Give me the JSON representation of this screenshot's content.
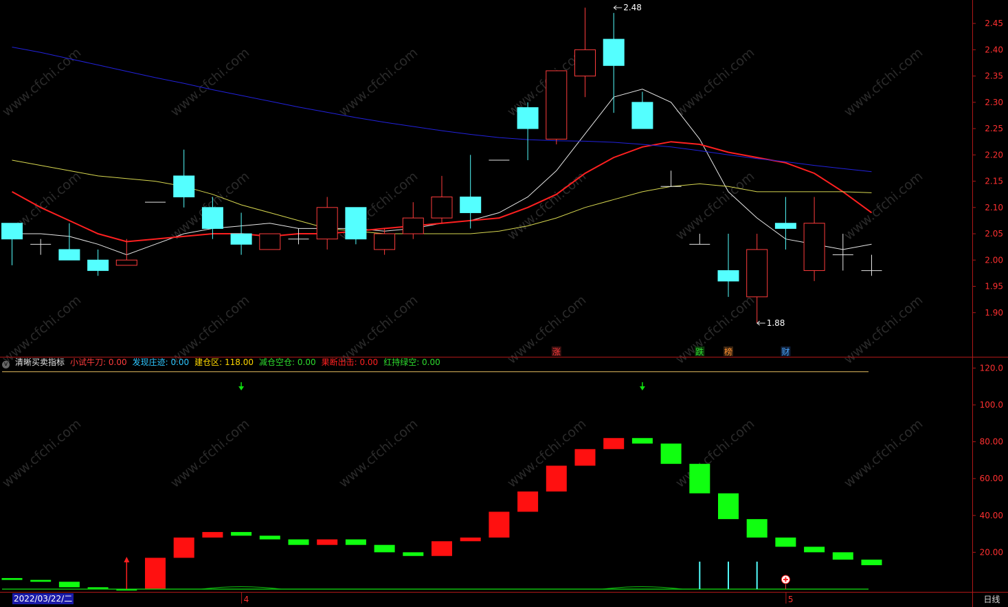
{
  "colors": {
    "up": "#ff3c3c",
    "down": "#54ffff",
    "flat": "#e6e6e6",
    "axis": "#b01818",
    "ma_white": "#e8e8e8",
    "ma_red": "#ff2020",
    "ma_yellow": "#d8d850",
    "ma_blue": "#2222dd",
    "bar_red": "#ff1010",
    "bar_green": "#10ff10"
  },
  "indicator": {
    "collapse_icon": "chevron-down-icon",
    "name": "清晰买卖指标",
    "items": [
      {
        "label": "小试牛刀:",
        "value": "0.00",
        "color": "#ff3c3c"
      },
      {
        "label": "发现庄迹:",
        "value": "0.00",
        "color": "#2ec6ff"
      },
      {
        "label": "建仓区:",
        "value": "118.00",
        "color": "#ffd800"
      },
      {
        "label": "减仓空仓:",
        "value": "0.00",
        "color": "#2edc2e"
      },
      {
        "label": "果断出击:",
        "value": "0.00",
        "color": "#ff2020"
      },
      {
        "label": "红持绿空:",
        "value": "0.00",
        "color": "#2edc2e"
      }
    ]
  },
  "footer": {
    "date": "2022/03/22/二",
    "period": "日线"
  },
  "chart_data": [
    {
      "type": "candlestick",
      "ylim": [
        1.85,
        2.475
      ],
      "y_ticks": [
        "2.45",
        "2.40",
        "2.35",
        "2.30",
        "2.25",
        "2.20",
        "2.15",
        "2.10",
        "2.05",
        "2.00",
        "1.95",
        "1.90"
      ],
      "x_ticks": [
        {
          "index": 8,
          "label": "4"
        },
        {
          "index": 27,
          "label": "5"
        }
      ],
      "candles": [
        {
          "o": 2.07,
          "h": 2.07,
          "l": 1.99,
          "c": 2.04
        },
        {
          "o": 2.03,
          "h": 2.04,
          "l": 2.01,
          "c": 2.03
        },
        {
          "o": 2.02,
          "h": 2.07,
          "l": 2.0,
          "c": 2.0
        },
        {
          "o": 2.0,
          "h": 2.02,
          "l": 1.97,
          "c": 1.98
        },
        {
          "o": 1.99,
          "h": 2.04,
          "l": 1.99,
          "c": 2.0
        },
        {
          "o": 2.11,
          "h": 2.11,
          "l": 2.11,
          "c": 2.11
        },
        {
          "o": 2.16,
          "h": 2.21,
          "l": 2.1,
          "c": 2.12
        },
        {
          "o": 2.1,
          "h": 2.12,
          "l": 2.04,
          "c": 2.06
        },
        {
          "o": 2.05,
          "h": 2.09,
          "l": 2.01,
          "c": 2.03
        },
        {
          "o": 2.02,
          "h": 2.05,
          "l": 2.02,
          "c": 2.05
        },
        {
          "o": 2.04,
          "h": 2.06,
          "l": 2.03,
          "c": 2.04
        },
        {
          "o": 2.04,
          "h": 2.12,
          "l": 2.02,
          "c": 2.1
        },
        {
          "o": 2.1,
          "h": 2.1,
          "l": 2.03,
          "c": 2.04
        },
        {
          "o": 2.02,
          "h": 2.06,
          "l": 2.01,
          "c": 2.05
        },
        {
          "o": 2.05,
          "h": 2.11,
          "l": 2.04,
          "c": 2.08
        },
        {
          "o": 2.08,
          "h": 2.16,
          "l": 2.07,
          "c": 2.12
        },
        {
          "o": 2.12,
          "h": 2.2,
          "l": 2.06,
          "c": 2.09
        },
        {
          "o": 2.19,
          "h": 2.19,
          "l": 2.19,
          "c": 2.19
        },
        {
          "o": 2.29,
          "h": 2.3,
          "l": 2.19,
          "c": 2.25
        },
        {
          "o": 2.23,
          "h": 2.36,
          "l": 2.22,
          "c": 2.36
        },
        {
          "o": 2.35,
          "h": 2.48,
          "l": 2.31,
          "c": 2.4
        },
        {
          "o": 2.42,
          "h": 2.47,
          "l": 2.28,
          "c": 2.37
        },
        {
          "o": 2.3,
          "h": 2.32,
          "l": 2.25,
          "c": 2.25
        },
        {
          "o": 2.14,
          "h": 2.17,
          "l": 2.14,
          "c": 2.14
        },
        {
          "o": 2.03,
          "h": 2.05,
          "l": 2.03,
          "c": 2.03
        },
        {
          "o": 1.98,
          "h": 2.05,
          "l": 1.93,
          "c": 1.96
        },
        {
          "o": 1.93,
          "h": 2.05,
          "l": 1.88,
          "c": 2.02
        },
        {
          "o": 2.07,
          "h": 2.12,
          "l": 2.02,
          "c": 2.06
        },
        {
          "o": 1.98,
          "h": 2.12,
          "l": 1.96,
          "c": 2.07
        },
        {
          "o": 2.01,
          "h": 2.05,
          "l": 1.98,
          "c": 2.01
        },
        {
          "o": 1.98,
          "h": 2.01,
          "l": 1.97,
          "c": 1.98
        }
      ],
      "ma": [
        {
          "color": "#e8e8e8",
          "values": [
            2.05,
            2.05,
            2.045,
            2.03,
            2.01,
            2.03,
            2.05,
            2.06,
            2.065,
            2.07,
            2.06,
            2.06,
            2.06,
            2.055,
            2.06,
            2.07,
            2.075,
            2.09,
            2.12,
            2.17,
            2.24,
            2.31,
            2.325,
            2.3,
            2.23,
            2.13,
            2.08,
            2.04,
            2.03,
            2.02,
            2.03
          ]
        },
        {
          "color": "#ff2020",
          "width": 2,
          "values": [
            2.13,
            2.1,
            2.075,
            2.05,
            2.035,
            2.04,
            2.045,
            2.05,
            2.05,
            2.045,
            2.05,
            2.05,
            2.055,
            2.06,
            2.065,
            2.07,
            2.075,
            2.08,
            2.1,
            2.125,
            2.165,
            2.195,
            2.215,
            2.225,
            2.22,
            2.205,
            2.195,
            2.185,
            2.165,
            2.13,
            2.09
          ]
        },
        {
          "color": "#d8d850",
          "values": [
            2.19,
            2.18,
            2.17,
            2.16,
            2.155,
            2.15,
            2.14,
            2.125,
            2.105,
            2.09,
            2.075,
            2.06,
            2.055,
            2.05,
            2.05,
            2.05,
            2.05,
            2.055,
            2.065,
            2.08,
            2.1,
            2.115,
            2.13,
            2.14,
            2.145,
            2.14,
            2.13,
            2.13,
            2.13,
            2.13,
            2.128
          ]
        },
        {
          "color": "#2222dd",
          "values": [
            2.405,
            2.395,
            2.383,
            2.371,
            2.359,
            2.347,
            2.336,
            2.324,
            2.313,
            2.302,
            2.291,
            2.281,
            2.271,
            2.262,
            2.254,
            2.246,
            2.239,
            2.233,
            2.229,
            2.227,
            2.226,
            2.224,
            2.22,
            2.215,
            2.208,
            2.2,
            2.193,
            2.187,
            2.18,
            2.174,
            2.168
          ]
        }
      ],
      "annotations": [
        {
          "index": 21,
          "value": 2.48,
          "label": "2.48"
        },
        {
          "index": 26,
          "value": 1.88,
          "label": "1.88"
        }
      ],
      "badges": [
        {
          "index": 19,
          "label": "涨",
          "color": "#ff3c3c",
          "bg": "#3a1010"
        },
        {
          "index": 24,
          "label": "跌",
          "color": "#2edc2e",
          "bg": "#0e3a0e"
        },
        {
          "index": 25,
          "label": "榜",
          "color": "#ff9030",
          "bg": "#3a2410"
        },
        {
          "index": 27,
          "label": "财",
          "color": "#4aa8ff",
          "bg": "#10203a"
        }
      ]
    },
    {
      "type": "bar",
      "ylim": [
        0,
        125
      ],
      "y_ticks": [
        "120.0",
        "100.0",
        "80.00",
        "60.00",
        "40.00",
        "20.00"
      ],
      "reference_line": 118,
      "segments": [
        {
          "from": 6,
          "to": 5,
          "color": "green"
        },
        {
          "from": 5,
          "to": 4,
          "color": "green"
        },
        {
          "from": 4,
          "to": 1,
          "color": "green"
        },
        {
          "from": 1,
          "to": 0,
          "color": "green"
        },
        {
          "from": 0,
          "to": 0,
          "color": "green"
        },
        {
          "from": 0,
          "to": 17,
          "color": "red"
        },
        {
          "from": 17,
          "to": 28,
          "color": "red"
        },
        {
          "from": 28,
          "to": 31,
          "color": "red"
        },
        {
          "from": 31,
          "to": 29,
          "color": "green"
        },
        {
          "from": 29,
          "to": 27,
          "color": "green"
        },
        {
          "from": 27,
          "to": 24,
          "color": "green"
        },
        {
          "from": 24,
          "to": 27,
          "color": "red"
        },
        {
          "from": 27,
          "to": 24,
          "color": "green"
        },
        {
          "from": 24,
          "to": 20,
          "color": "green"
        },
        {
          "from": 20,
          "to": 18,
          "color": "green"
        },
        {
          "from": 18,
          "to": 26,
          "color": "red"
        },
        {
          "from": 26,
          "to": 28,
          "color": "red"
        },
        {
          "from": 28,
          "to": 42,
          "color": "red"
        },
        {
          "from": 42,
          "to": 53,
          "color": "red"
        },
        {
          "from": 53,
          "to": 67,
          "color": "red"
        },
        {
          "from": 67,
          "to": 76,
          "color": "red"
        },
        {
          "from": 76,
          "to": 82,
          "color": "red"
        },
        {
          "from": 82,
          "to": 79,
          "color": "green"
        },
        {
          "from": 79,
          "to": 68,
          "color": "green"
        },
        {
          "from": 68,
          "to": 52,
          "color": "green"
        },
        {
          "from": 52,
          "to": 38,
          "color": "green"
        },
        {
          "from": 38,
          "to": 28,
          "color": "green"
        },
        {
          "from": 28,
          "to": 23,
          "color": "green"
        },
        {
          "from": 23,
          "to": 20,
          "color": "green"
        },
        {
          "from": 20,
          "to": 16,
          "color": "green"
        },
        {
          "from": 16,
          "to": 13,
          "color": "green"
        }
      ],
      "down_arrows": [
        8,
        22
      ],
      "up_arrow": 4,
      "cyan_spikes": [
        24,
        25,
        26
      ],
      "plus_marker": 27
    }
  ]
}
